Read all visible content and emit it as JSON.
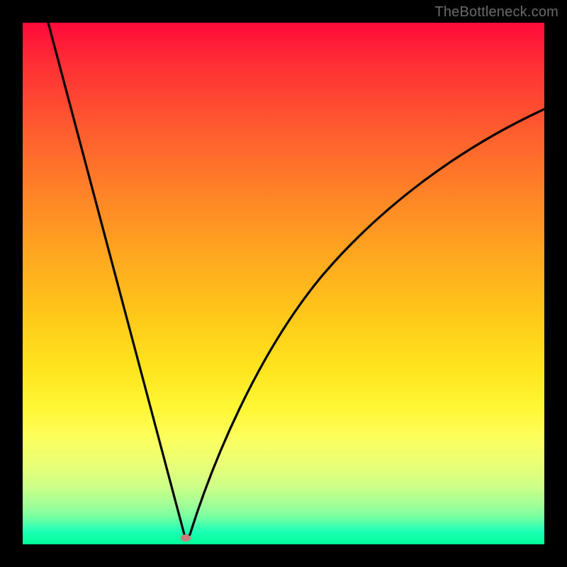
{
  "watermark": "TheBottleneck.com",
  "colors": {
    "frame": "#000000",
    "curve": "#000000",
    "dot": "#cd7a7a",
    "gradient_top": "#ff0a3a",
    "gradient_bottom": "#00ff99"
  },
  "chart_data": {
    "type": "line",
    "title": "",
    "xlabel": "",
    "ylabel": "",
    "xlim": [
      0,
      100
    ],
    "ylim": [
      0,
      100
    ],
    "grid": false,
    "legend": false,
    "annotations": [
      {
        "name": "minimum-marker",
        "x": 31,
        "y": 1
      }
    ],
    "series": [
      {
        "name": "bottleneck-curve",
        "x": [
          0,
          4,
          8,
          12,
          16,
          20,
          24,
          27,
          29,
          30,
          31,
          32,
          34,
          36,
          40,
          45,
          50,
          55,
          60,
          65,
          70,
          75,
          80,
          85,
          90,
          95,
          100
        ],
        "y": [
          100,
          87,
          74,
          61,
          49,
          36,
          23,
          13,
          6,
          3,
          1,
          3,
          9,
          15,
          26,
          37,
          46,
          53,
          60,
          65,
          69,
          73,
          76,
          79,
          81,
          83,
          84
        ]
      }
    ]
  }
}
